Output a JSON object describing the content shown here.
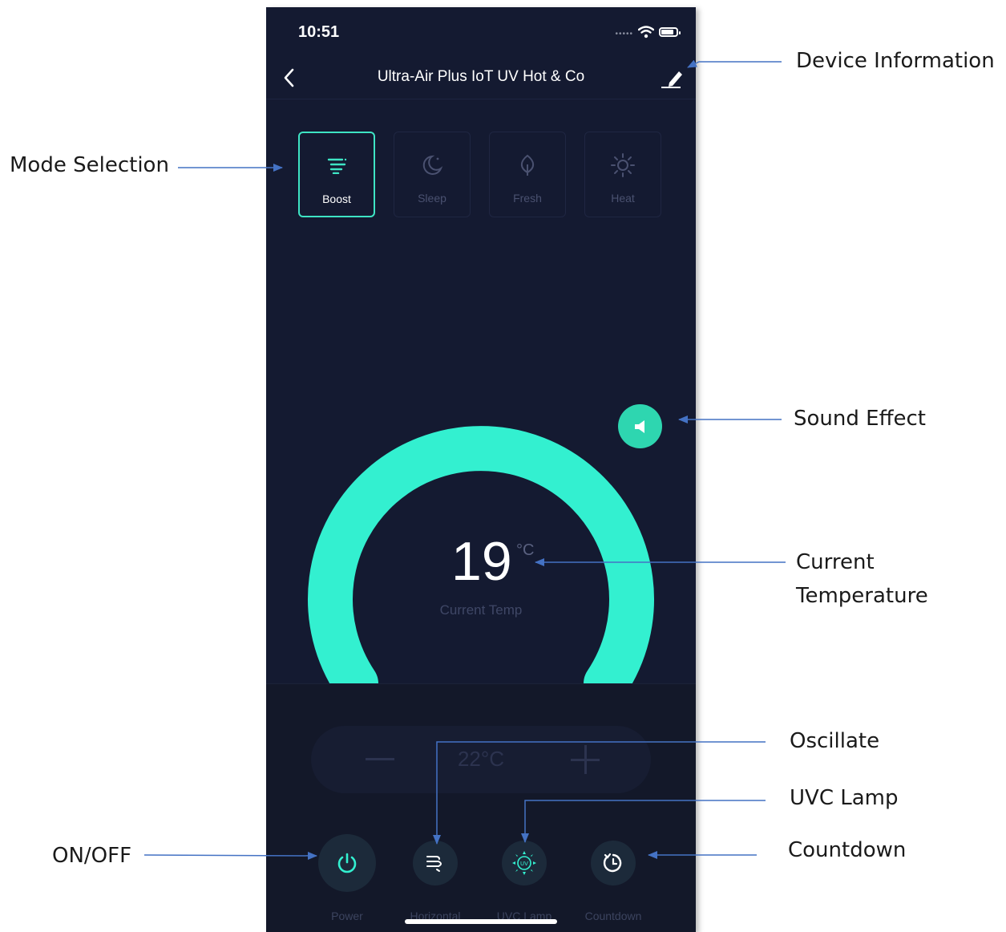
{
  "status_bar": {
    "time": "10:51",
    "signal": "•••••"
  },
  "nav": {
    "title": "Ultra-Air Plus IoT UV Hot & Co"
  },
  "modes": [
    {
      "label": "Boost",
      "icon": "boost-icon",
      "active": true
    },
    {
      "label": "Sleep",
      "icon": "moon-icon",
      "active": false
    },
    {
      "label": "Fresh",
      "icon": "leaf-icon",
      "active": false
    },
    {
      "label": "Heat",
      "icon": "sun-icon",
      "active": false
    }
  ],
  "temperature": {
    "value": "19",
    "unit": "°C",
    "label": "Current Temp"
  },
  "setpoint": {
    "value": "22°C",
    "minus": "—",
    "plus": "+"
  },
  "controls": [
    {
      "label": "Power",
      "icon": "power-icon"
    },
    {
      "label": "Horizontal",
      "icon": "oscillate-icon"
    },
    {
      "label": "UVC Lamp",
      "icon": "uv-lamp-icon"
    },
    {
      "label": "Countdown",
      "icon": "timer-icon"
    }
  ],
  "annotations": {
    "device_information": "Device Information",
    "mode_selection": "Mode Selection",
    "sound_effect": "Sound Effect",
    "current_temperature_line1": "Current",
    "current_temperature_line2": "Temperature",
    "oscillate": "Oscillate",
    "uvc_lamp": "UVC Lamp",
    "countdown": "Countdown",
    "on_off": "ON/OFF"
  },
  "colors": {
    "background": "#141a31",
    "accent": "#33f0d0",
    "arrow": "#4472c4"
  }
}
